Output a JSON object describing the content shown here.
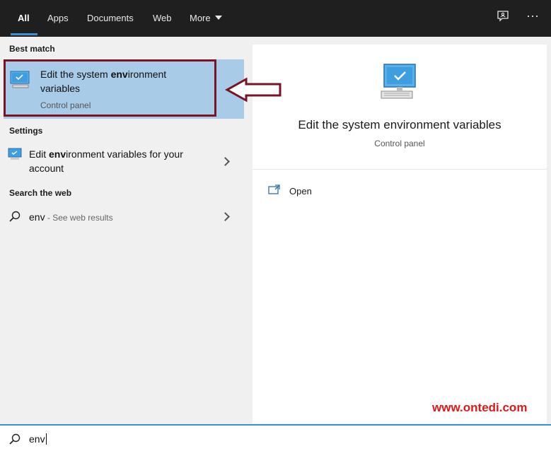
{
  "tabs": [
    {
      "label": "All",
      "active": true
    },
    {
      "label": "Apps"
    },
    {
      "label": "Documents"
    },
    {
      "label": "Web"
    },
    {
      "label": "More"
    }
  ],
  "top_icons": {
    "feedback": "feedback-icon",
    "more": "ellipsis-icon",
    "more_glyph": "···"
  },
  "best_match": {
    "heading": "Best match",
    "title_pre": "Edit the system ",
    "title_bold": "env",
    "title_post": "ironment",
    "title_line2": "variables",
    "subtitle": "Control panel",
    "icon": "monitor-icon"
  },
  "settings": {
    "heading": "Settings",
    "item_pre": "Edit ",
    "item_bold": "env",
    "item_post": "ironment variables for your",
    "item_line2": "account",
    "icon": "settings-monitor-icon"
  },
  "web": {
    "heading": "Search the web",
    "query": "env",
    "suffix": " - See web results",
    "icon": "search-icon"
  },
  "preview": {
    "title": "Edit the system environment variables",
    "subtitle": "Control panel",
    "action_label": "Open",
    "icon": "monitor-icon"
  },
  "search_box": {
    "value": "env"
  },
  "watermark": "www.ontedi.com",
  "colors": {
    "accent": "#3c8fd6",
    "highlight": "#a8cbe8",
    "annotation": "#7a1424",
    "watermark": "#e01818"
  }
}
